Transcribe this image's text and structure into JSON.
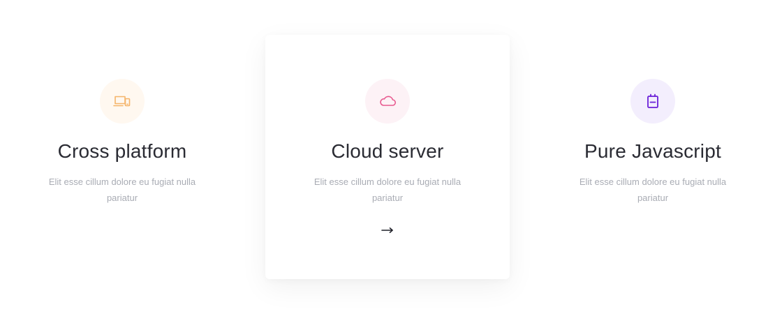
{
  "features": [
    {
      "title": "Cross platform",
      "description": "Elit esse cillum dolore eu fugiat nulla pariatur",
      "icon": "devices-icon",
      "icon_color": "#f5b46a",
      "icon_bg": "#fff8f0"
    },
    {
      "title": "Cloud server",
      "description": "Elit esse cillum dolore eu fugiat nulla pariatur",
      "icon": "cloud-icon",
      "icon_color": "#e85a8f",
      "icon_bg": "#fdf2f6",
      "link_icon": "arrow-right-icon",
      "highlighted": true
    },
    {
      "title": "Pure Javascript",
      "description": "Elit esse cillum dolore eu fugiat nulla pariatur",
      "icon": "file-icon",
      "icon_color": "#6a1fd8",
      "icon_bg": "#f3eefd"
    }
  ]
}
